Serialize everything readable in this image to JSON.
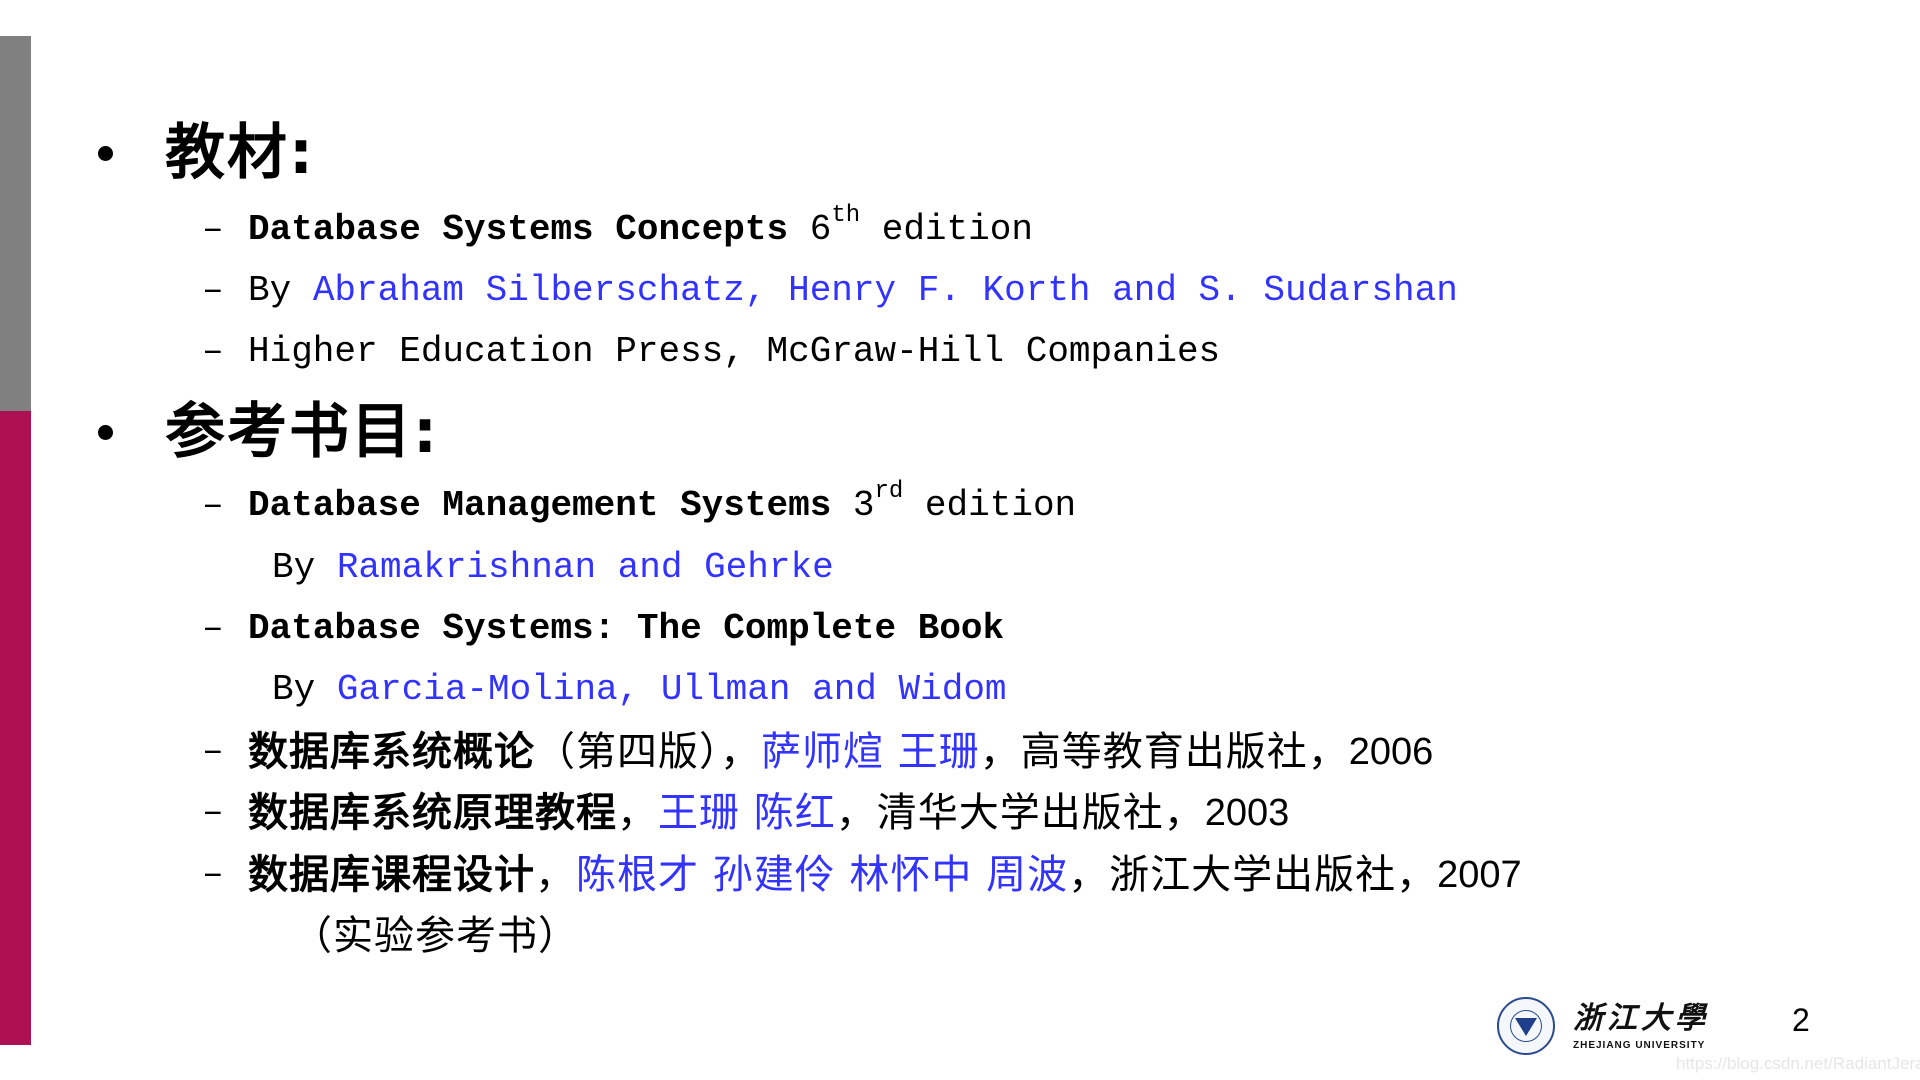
{
  "slide": {
    "accent_colors": {
      "bar_top": "#808080",
      "bar_bottom": "#ad1152",
      "link_blue": "#3333ff"
    },
    "sections": [
      {
        "heading": "教材:",
        "items": [
          {
            "title": "Database Systems Concepts",
            "edition_num": "6",
            "edition_sup": "th",
            "edition_word": " edition"
          },
          {
            "prefix": "By ",
            "authors": "Abraham Silberschatz, Henry F. Korth and S. Sudarshan"
          },
          {
            "publisher": "Higher Education Press, McGraw-Hill Companies"
          }
        ]
      },
      {
        "heading": "参考书目:",
        "items": [
          {
            "title": "Database Management Systems",
            "edition_num": "3",
            "edition_sup": "rd",
            "edition_word": " edition",
            "by_prefix": "By ",
            "authors": "Ramakrishnan and Gehrke"
          },
          {
            "title": "Database Systems: The Complete Book",
            "by_prefix": "By ",
            "authors": "Garcia-Molina, Ullman and Widom"
          },
          {
            "title": "数据库系统概论",
            "note": "（第四版），",
            "authors": "萨师煊 王珊",
            "rest": "，高等教育出版社，",
            "year": "2006"
          },
          {
            "title": "数据库系统原理教程",
            "sep": "，",
            "authors": "王珊 陈红",
            "rest": "，清华大学出版社，",
            "year": "2003"
          },
          {
            "title": "数据库课程设计",
            "sep": "，",
            "authors": "陈根才 孙建伶 林怀中 周波",
            "rest": "，浙江大学出版社，",
            "year": "2007",
            "note_line": "（实验参考书）"
          }
        ]
      }
    ],
    "footer": {
      "logo_cn": "浙江大學",
      "logo_en": "ZHEJIANG UNIVERSITY",
      "logo_icon": "university-seal-icon",
      "page_number": "2",
      "watermark": "https://blog.csdn.net/RadiantJeral"
    },
    "bullet_glyph": "•",
    "dash_glyph": "–"
  }
}
